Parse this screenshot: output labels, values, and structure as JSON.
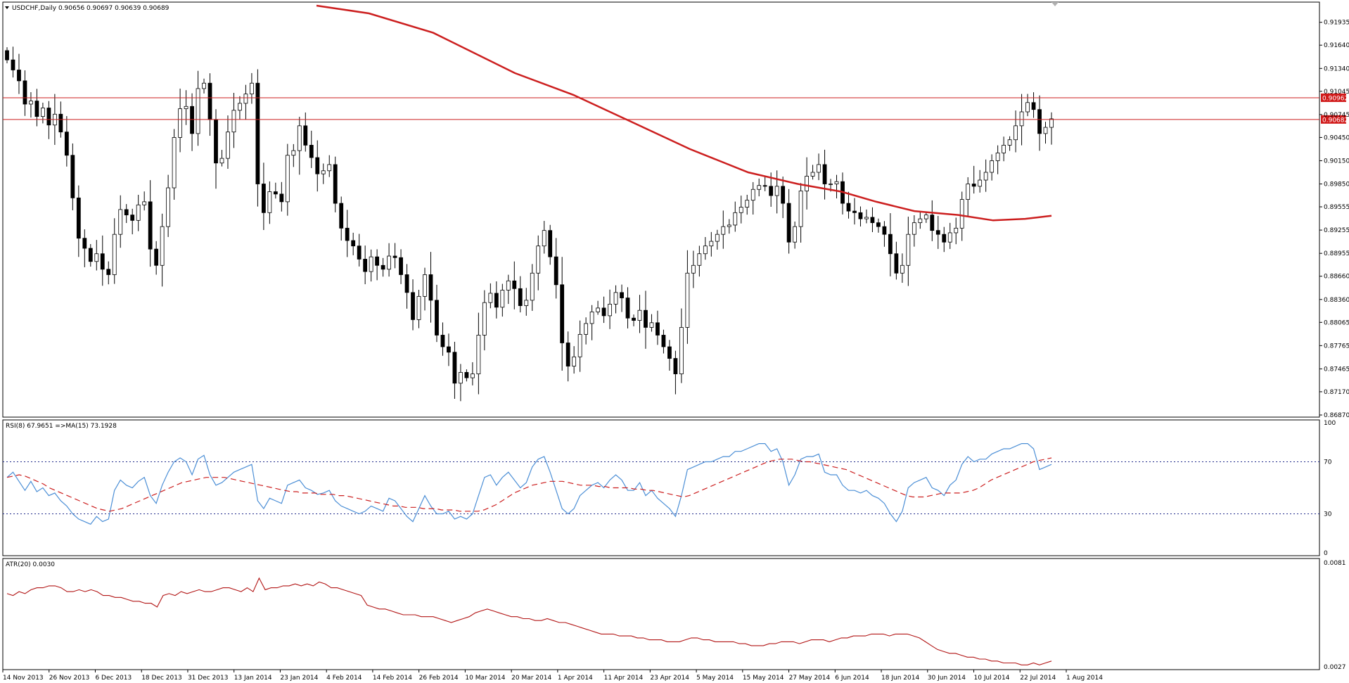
{
  "header": {
    "symbol_line": "USDCHF,Daily  0.90656 0.90697 0.90639 0.90689"
  },
  "subwindows": {
    "rsi_title": "RSI(8) 67.9651   =>MA(15) 73.1928",
    "atr_title": "ATR(20) 0.0030"
  },
  "colors": {
    "bull_body": "#ffffff",
    "bear_body": "#000000",
    "ma_line": "#cc1f1f",
    "hline": "#cc1f1f",
    "price_label_bg": "#d11a1a",
    "rsi_line": "#4c8fd6",
    "rsi_ma": "#cc1f1f",
    "atr_line": "#b21515",
    "grid_dots": "#1f2a8a"
  },
  "chart_data": [
    {
      "type": "candlestick",
      "title": "USDCHF,Daily",
      "ylim": [
        0.8687,
        0.9215
      ],
      "yticks": [
        "0.91935",
        "0.91640",
        "0.91340",
        "0.91045",
        "0.90745",
        "0.90450",
        "0.90150",
        "0.89850",
        "0.89555",
        "0.89255",
        "0.88955",
        "0.88660",
        "0.88360",
        "0.88065",
        "0.87765",
        "0.87465",
        "0.87170",
        "0.86870"
      ],
      "xlabels": [
        "14 Nov 2013",
        "26 Nov 2013",
        "6 Dec 2013",
        "18 Dec 2013",
        "31 Dec 2013",
        "13 Jan 2014",
        "23 Jan 2014",
        "4 Feb 2014",
        "14 Feb 2014",
        "26 Feb 2014",
        "10 Mar 2014",
        "20 Mar 2014",
        "1 Apr 2014",
        "11 Apr 2014",
        "23 Apr 2014",
        "5 May 2014",
        "15 May 2014",
        "27 May 2014",
        "6 Jun 2014",
        "18 Jun 2014",
        "30 Jun 2014",
        "10 Jul 2014",
        "22 Jul 2014",
        "1 Aug 2014"
      ],
      "horizontal_lines": [
        {
          "value": 0.90962,
          "label": "0.90962"
        },
        {
          "value": 0.90682,
          "label": "0.90682"
        }
      ],
      "closes": [
        0.9145,
        0.9132,
        0.9118,
        0.9088,
        0.9092,
        0.9072,
        0.9083,
        0.9061,
        0.9075,
        0.9052,
        0.9022,
        0.8967,
        0.8915,
        0.8902,
        0.8885,
        0.8895,
        0.8875,
        0.8868,
        0.892,
        0.8952,
        0.8945,
        0.8938,
        0.8958,
        0.8962,
        0.8901,
        0.888,
        0.893,
        0.898,
        0.9045,
        0.9082,
        0.9085,
        0.905,
        0.9108,
        0.9115,
        0.9068,
        0.9012,
        0.9018,
        0.9052,
        0.908,
        0.9089,
        0.9101,
        0.9115,
        0.8985,
        0.8948,
        0.8975,
        0.8972,
        0.8962,
        0.9022,
        0.9028,
        0.906,
        0.9035,
        0.9019,
        0.8998,
        0.9002,
        0.901,
        0.896,
        0.8928,
        0.8912,
        0.8905,
        0.8888,
        0.8872,
        0.8891,
        0.888,
        0.8875,
        0.8892,
        0.889,
        0.8868,
        0.8845,
        0.881,
        0.884,
        0.8868,
        0.8835,
        0.879,
        0.8775,
        0.8768,
        0.8728,
        0.8742,
        0.8735,
        0.874,
        0.879,
        0.8832,
        0.8844,
        0.8826,
        0.8848,
        0.886,
        0.885,
        0.8828,
        0.8835,
        0.887,
        0.8905,
        0.8925,
        0.8891,
        0.8855,
        0.878,
        0.875,
        0.8762,
        0.8791,
        0.8805,
        0.882,
        0.8825,
        0.8815,
        0.883,
        0.8845,
        0.8838,
        0.8812,
        0.8809,
        0.8822,
        0.88,
        0.8806,
        0.879,
        0.8775,
        0.876,
        0.874,
        0.88,
        0.887,
        0.888,
        0.8895,
        0.8905,
        0.8911,
        0.892,
        0.893,
        0.8932,
        0.8948,
        0.8955,
        0.8964,
        0.8978,
        0.8983,
        0.8982,
        0.897,
        0.8982,
        0.896,
        0.891,
        0.893,
        0.8976,
        0.8995,
        0.9,
        0.901,
        0.8985,
        0.8985,
        0.8988,
        0.896,
        0.895,
        0.8948,
        0.894,
        0.8942,
        0.8935,
        0.893,
        0.892,
        0.8895,
        0.887,
        0.888,
        0.892,
        0.8935,
        0.894,
        0.8945,
        0.8925,
        0.892,
        0.891,
        0.8922,
        0.8928,
        0.8965,
        0.8985,
        0.8982,
        0.899,
        0.9,
        0.9015,
        0.9025,
        0.9035,
        0.9042,
        0.906,
        0.9078,
        0.909,
        0.9081,
        0.905,
        0.9058,
        0.9069
      ],
      "moving_average_points": [
        [
          0.24,
          0.9215
        ],
        [
          0.28,
          0.9205
        ],
        [
          0.32,
          0.9185
        ],
        [
          0.36,
          0.9128
        ],
        [
          0.4,
          0.91
        ],
        [
          0.44,
          0.9065
        ],
        [
          0.48,
          0.903
        ],
        [
          0.52,
          0.8998
        ],
        [
          0.56,
          0.8985
        ],
        [
          0.6,
          0.8975
        ],
        [
          0.64,
          0.8962
        ],
        [
          0.68,
          0.895
        ],
        [
          0.72,
          0.8945
        ],
        [
          0.76,
          0.8938
        ],
        [
          0.8,
          0.8938
        ],
        [
          0.79,
          0.894
        ]
      ],
      "moving_average_days": [
        [
          0,
          0.9215
        ],
        [
          18,
          0.9205
        ],
        [
          40,
          0.918
        ],
        [
          68,
          0.9128
        ],
        [
          88,
          0.91
        ],
        [
          108,
          0.9065
        ],
        [
          128,
          0.903
        ],
        [
          148,
          0.9
        ],
        [
          165,
          0.8985
        ],
        [
          180,
          0.8975
        ],
        [
          192,
          0.8962
        ],
        [
          205,
          0.895
        ],
        [
          220,
          0.8945
        ],
        [
          232,
          0.8938
        ],
        [
          243,
          0.894
        ],
        [
          252,
          0.8944
        ]
      ]
    },
    {
      "type": "line",
      "title": "RSI(8)",
      "ylim": [
        0,
        100
      ],
      "yticks": [
        "100",
        "70",
        "30",
        "0"
      ],
      "levels": [
        70,
        30
      ],
      "series": [
        {
          "name": "RSI(8)",
          "values": [
            58,
            62,
            55,
            48,
            55,
            47,
            50,
            44,
            46,
            40,
            36,
            30,
            26,
            24,
            22,
            28,
            24,
            26,
            48,
            56,
            52,
            50,
            55,
            58,
            44,
            38,
            52,
            62,
            70,
            73,
            70,
            60,
            72,
            75,
            60,
            52,
            54,
            58,
            62,
            64,
            66,
            68,
            40,
            34,
            42,
            40,
            38,
            52,
            54,
            56,
            50,
            48,
            45,
            46,
            48,
            40,
            36,
            34,
            32,
            30,
            32,
            36,
            34,
            32,
            42,
            40,
            34,
            28,
            24,
            34,
            44,
            36,
            30,
            30,
            32,
            26,
            28,
            26,
            30,
            44,
            58,
            60,
            52,
            58,
            62,
            56,
            50,
            54,
            66,
            72,
            74,
            62,
            48,
            34,
            30,
            34,
            44,
            48,
            52,
            54,
            50,
            56,
            60,
            56,
            48,
            48,
            54,
            44,
            48,
            42,
            38,
            34,
            28,
            44,
            64,
            66,
            68,
            70,
            70,
            72,
            74,
            74,
            78,
            78,
            80,
            82,
            84,
            84,
            78,
            80,
            70,
            52,
            60,
            72,
            74,
            74,
            76,
            62,
            60,
            60,
            52,
            48,
            48,
            46,
            48,
            44,
            42,
            38,
            30,
            24,
            32,
            50,
            54,
            56,
            58,
            50,
            48,
            44,
            52,
            56,
            68,
            74,
            70,
            72,
            72,
            76,
            78,
            80,
            80,
            82,
            84,
            84,
            80,
            64,
            66,
            68
          ]
        },
        {
          "name": "MA(15)",
          "values": [
            58,
            59,
            60,
            59,
            57,
            55,
            53,
            50,
            48,
            46,
            44,
            42,
            40,
            38,
            36,
            34,
            33,
            32,
            33,
            34,
            36,
            38,
            40,
            42,
            44,
            46,
            48,
            50,
            52,
            54,
            55,
            56,
            57,
            58,
            58,
            58,
            58,
            57,
            56,
            55,
            54,
            53,
            52,
            51,
            50,
            49,
            48,
            47,
            47,
            46,
            46,
            46,
            45,
            45,
            45,
            44,
            44,
            43,
            42,
            41,
            40,
            39,
            38,
            37,
            36,
            36,
            35,
            35,
            35,
            34,
            34,
            34,
            33,
            33,
            33,
            32,
            32,
            32,
            32,
            33,
            35,
            37,
            40,
            43,
            46,
            48,
            50,
            52,
            53,
            54,
            55,
            55,
            55,
            54,
            53,
            52,
            52,
            52,
            51,
            51,
            50,
            50,
            50,
            50,
            49,
            49,
            48,
            48,
            47,
            46,
            45,
            44,
            43,
            44,
            46,
            48,
            50,
            52,
            54,
            56,
            58,
            60,
            62,
            64,
            66,
            68,
            70,
            71,
            72,
            72,
            72,
            71,
            70,
            70,
            69,
            68,
            67,
            66,
            65,
            64,
            62,
            60,
            58,
            56,
            54,
            52,
            50,
            48,
            46,
            44,
            43,
            43,
            43,
            44,
            45,
            46,
            46,
            46,
            46,
            47,
            48,
            50,
            53,
            56,
            58,
            60,
            62,
            64,
            66,
            68,
            70,
            71,
            72,
            73
          ]
        }
      ]
    },
    {
      "type": "line",
      "title": "ATR(20)",
      "ylim": [
        0.0027,
        0.0081
      ],
      "yticks": [
        "0.0081",
        "0.0027"
      ],
      "series": [
        {
          "name": "ATR(20)",
          "values": [
            0.0065,
            0.0064,
            0.0066,
            0.0065,
            0.0067,
            0.0068,
            0.0068,
            0.0069,
            0.0069,
            0.0068,
            0.0066,
            0.0066,
            0.0067,
            0.0066,
            0.0067,
            0.0066,
            0.0064,
            0.0064,
            0.0063,
            0.0063,
            0.0062,
            0.0061,
            0.0061,
            0.006,
            0.006,
            0.0058,
            0.0064,
            0.0065,
            0.0064,
            0.0066,
            0.0065,
            0.0066,
            0.0067,
            0.0066,
            0.0066,
            0.0067,
            0.0068,
            0.0068,
            0.0067,
            0.0066,
            0.0068,
            0.0066,
            0.0073,
            0.0067,
            0.0068,
            0.0068,
            0.0069,
            0.0069,
            0.007,
            0.0069,
            0.007,
            0.0069,
            0.0071,
            0.007,
            0.0068,
            0.0068,
            0.0067,
            0.0066,
            0.0065,
            0.0064,
            0.0059,
            0.0058,
            0.0057,
            0.0057,
            0.0056,
            0.0055,
            0.0054,
            0.0054,
            0.0054,
            0.0053,
            0.0053,
            0.0053,
            0.0052,
            0.0051,
            0.005,
            0.0051,
            0.0052,
            0.0053,
            0.0055,
            0.0056,
            0.0057,
            0.0056,
            0.0055,
            0.0054,
            0.0053,
            0.0053,
            0.0052,
            0.0052,
            0.0051,
            0.0051,
            0.0052,
            0.0051,
            0.005,
            0.005,
            0.0049,
            0.0048,
            0.0047,
            0.0046,
            0.0045,
            0.0044,
            0.0044,
            0.0044,
            0.0043,
            0.0043,
            0.0043,
            0.0042,
            0.0042,
            0.0041,
            0.0041,
            0.0041,
            0.004,
            0.004,
            0.004,
            0.0041,
            0.0042,
            0.0042,
            0.0041,
            0.0041,
            0.004,
            0.004,
            0.004,
            0.004,
            0.0039,
            0.0039,
            0.0038,
            0.0038,
            0.0038,
            0.0039,
            0.0039,
            0.004,
            0.004,
            0.004,
            0.0039,
            0.004,
            0.0041,
            0.0041,
            0.0041,
            0.004,
            0.0041,
            0.0042,
            0.0042,
            0.0043,
            0.0043,
            0.0043,
            0.0044,
            0.0044,
            0.0044,
            0.0043,
            0.0044,
            0.0044,
            0.0044,
            0.0043,
            0.0042,
            0.004,
            0.0038,
            0.0036,
            0.0035,
            0.0034,
            0.0034,
            0.0033,
            0.0032,
            0.0032,
            0.0031,
            0.0031,
            0.003,
            0.003,
            0.0029,
            0.0029,
            0.0029,
            0.0028,
            0.0028,
            0.0029,
            0.0028,
            0.0029,
            0.003
          ]
        }
      ]
    }
  ]
}
